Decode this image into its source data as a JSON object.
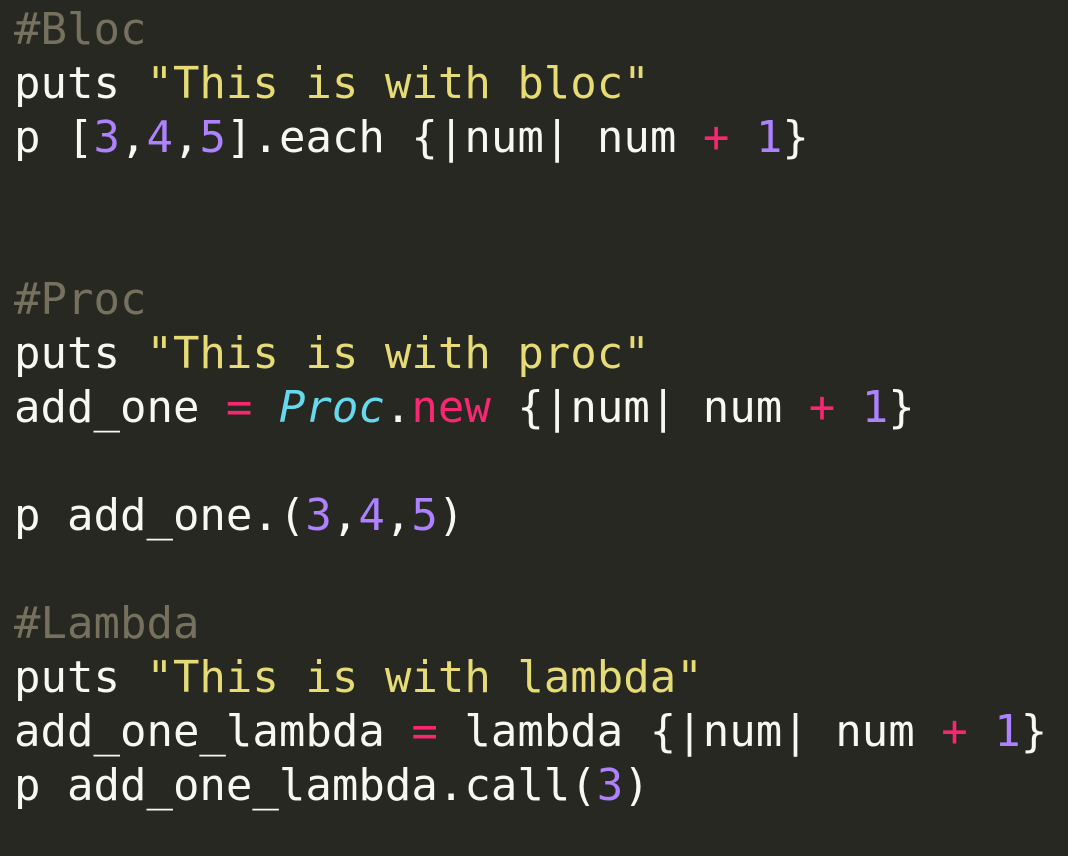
{
  "theme": {
    "background": "#272822",
    "default_text": "#f8f8f2",
    "comment": "#75715e",
    "string": "#e6db74",
    "number": "#ae81ff",
    "operator": "#f92672",
    "constant": "#66d9ef"
  },
  "lines": [
    {
      "tokens": [
        {
          "t": "#Bloc",
          "k": "comment"
        }
      ]
    },
    {
      "tokens": [
        {
          "t": "puts ",
          "k": ""
        },
        {
          "t": "\"This is with bloc\"",
          "k": "string"
        }
      ]
    },
    {
      "tokens": [
        {
          "t": "p [",
          "k": ""
        },
        {
          "t": "3",
          "k": "number"
        },
        {
          "t": ",",
          "k": ""
        },
        {
          "t": "4",
          "k": "number"
        },
        {
          "t": ",",
          "k": ""
        },
        {
          "t": "5",
          "k": "number"
        },
        {
          "t": "].each {|num| num ",
          "k": ""
        },
        {
          "t": "+",
          "k": "op"
        },
        {
          "t": " ",
          "k": ""
        },
        {
          "t": "1",
          "k": "number"
        },
        {
          "t": "}",
          "k": ""
        }
      ]
    },
    {
      "tokens": []
    },
    {
      "tokens": []
    },
    {
      "tokens": [
        {
          "t": "#Proc",
          "k": "comment"
        }
      ]
    },
    {
      "tokens": [
        {
          "t": "puts ",
          "k": ""
        },
        {
          "t": "\"This is with proc\"",
          "k": "string"
        }
      ]
    },
    {
      "tokens": [
        {
          "t": "add_one ",
          "k": ""
        },
        {
          "t": "=",
          "k": "op"
        },
        {
          "t": " ",
          "k": ""
        },
        {
          "t": "Proc",
          "k": "const"
        },
        {
          "t": ".",
          "k": ""
        },
        {
          "t": "new",
          "k": "keyword"
        },
        {
          "t": " {|num| num ",
          "k": ""
        },
        {
          "t": "+",
          "k": "op"
        },
        {
          "t": " ",
          "k": ""
        },
        {
          "t": "1",
          "k": "number"
        },
        {
          "t": "}",
          "k": ""
        }
      ]
    },
    {
      "tokens": []
    },
    {
      "tokens": [
        {
          "t": "p add_one.(",
          "k": ""
        },
        {
          "t": "3",
          "k": "number"
        },
        {
          "t": ",",
          "k": ""
        },
        {
          "t": "4",
          "k": "number"
        },
        {
          "t": ",",
          "k": ""
        },
        {
          "t": "5",
          "k": "number"
        },
        {
          "t": ")",
          "k": ""
        }
      ]
    },
    {
      "tokens": []
    },
    {
      "tokens": [
        {
          "t": "#Lambda",
          "k": "comment"
        }
      ]
    },
    {
      "tokens": [
        {
          "t": "puts ",
          "k": ""
        },
        {
          "t": "\"This is with lambda\"",
          "k": "string"
        }
      ]
    },
    {
      "tokens": [
        {
          "t": "add_one_lambda ",
          "k": ""
        },
        {
          "t": "=",
          "k": "op"
        },
        {
          "t": " lambda {|num| num ",
          "k": ""
        },
        {
          "t": "+",
          "k": "op"
        },
        {
          "t": " ",
          "k": ""
        },
        {
          "t": "1",
          "k": "number"
        },
        {
          "t": "}",
          "k": ""
        }
      ]
    },
    {
      "tokens": [
        {
          "t": "p add_one_lambda.call(",
          "k": ""
        },
        {
          "t": "3",
          "k": "number"
        },
        {
          "t": ")",
          "k": ""
        }
      ]
    }
  ]
}
